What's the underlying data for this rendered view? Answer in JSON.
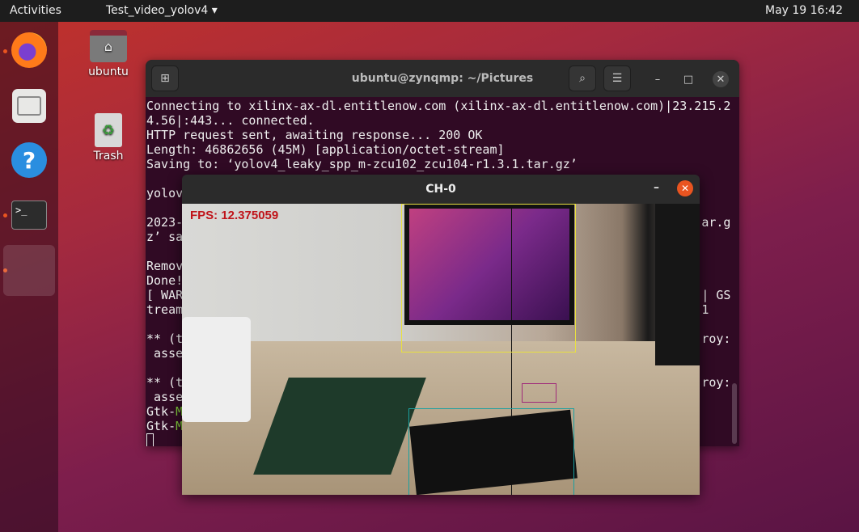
{
  "topbar": {
    "activities": "Activities",
    "app_menu": "Test_video_yolov4",
    "clock": "May 19  16:42"
  },
  "dock": {
    "items": [
      "firefox",
      "files",
      "help",
      "terminal",
      "show-applications"
    ]
  },
  "desktop": {
    "icons": [
      {
        "label": "ubuntu",
        "icon": "home-folder-icon"
      },
      {
        "label": "Trash",
        "icon": "trash-icon"
      }
    ]
  },
  "terminal": {
    "title": "ubuntu@zynqmp: ~/Pictures",
    "lines": [
      "Connecting to xilinx-ax-dl.entitlenow.com (xilinx-ax-dl.entitlenow.com)|23.215.2",
      "4.56|:443... connected.",
      "HTTP request sent, awaiting response... 200 OK",
      "Length: 46862656 (45M) [application/octet-stream]",
      "Saving to: ‘yolov4_leaky_spp_m-zcu102_zcu104-r1.3.1.tar.gz’",
      "",
      "yolov",
      "",
      "2023-                                                                       ar.g",
      "z’ sa",
      "",
      "Remov",
      "Done!",
      "[ WAR                                                                       | GS",
      "tream                                                                       1",
      "",
      "** (t                                                                       roy:",
      " asse",
      "",
      "** (t                                                                       roy:",
      " asse"
    ],
    "gtk_lines": [
      "Gtk-",
      "Gtk-"
    ],
    "gtk_green": [
      "M",
      "M"
    ]
  },
  "video": {
    "title": "CH-0",
    "fps": "FPS: 12.375059",
    "box_colors": [
      "#e8e040",
      "#a02a7a",
      "#1aa0a0"
    ]
  }
}
